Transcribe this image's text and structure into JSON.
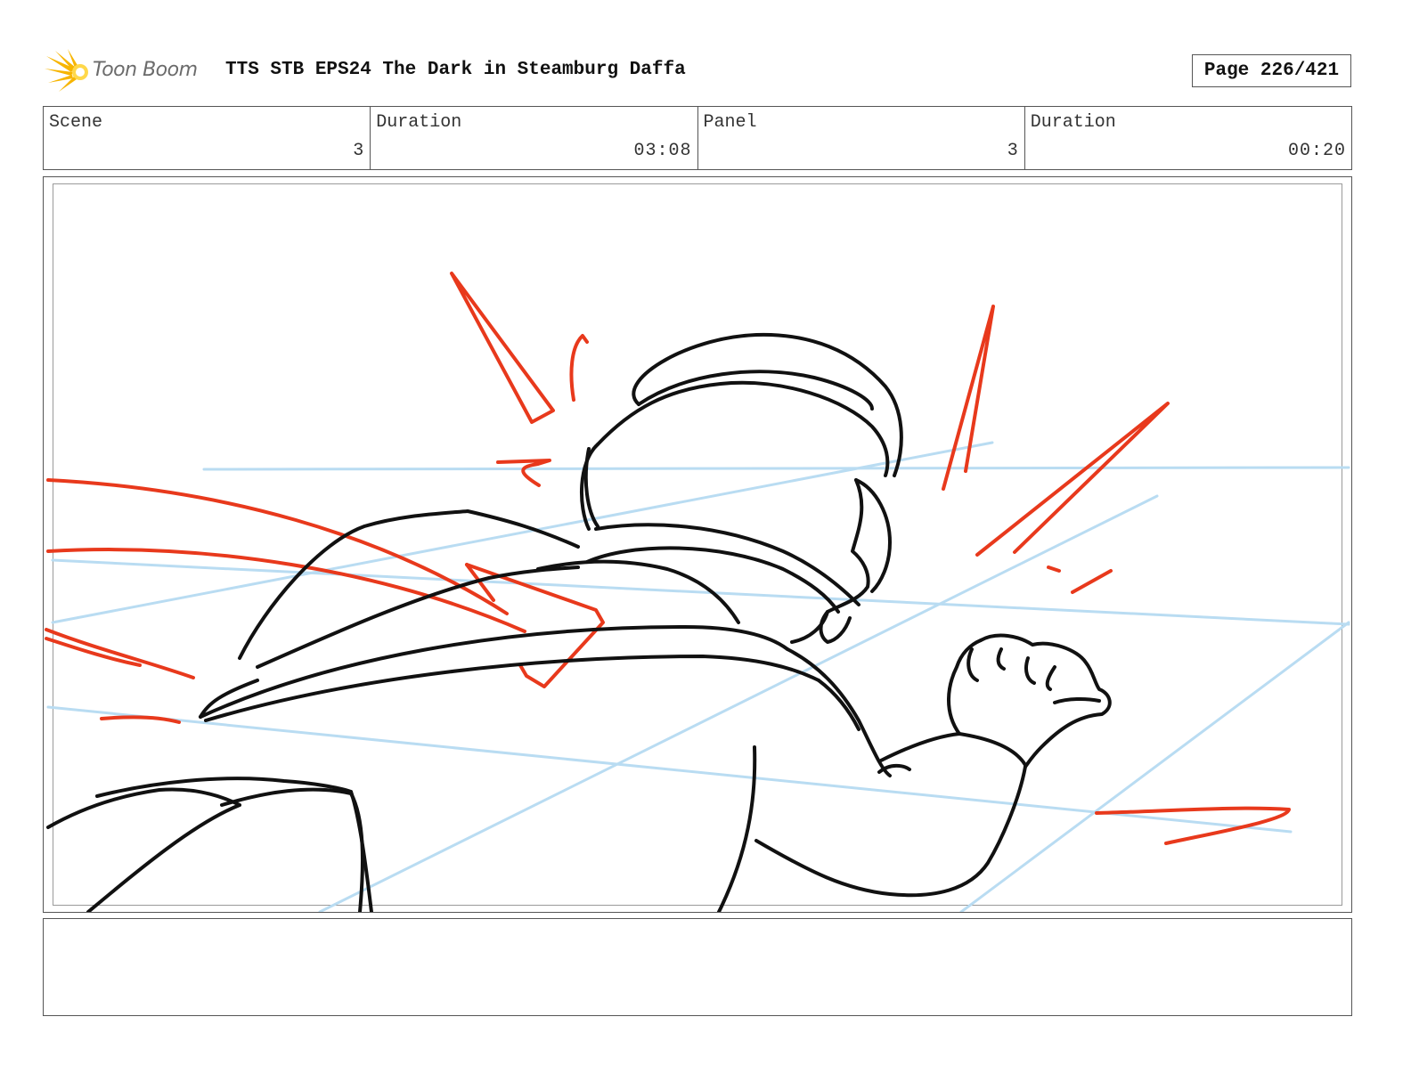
{
  "header": {
    "logo_text": "Toon Boom",
    "title": "TTS STB EPS24 The Dark in Steamburg Daffa",
    "page": "Page 226/421"
  },
  "info": [
    {
      "label": "Scene",
      "value": "3"
    },
    {
      "label": "Duration",
      "value": "03:08"
    },
    {
      "label": "Panel",
      "value": "3"
    },
    {
      "label": "Duration",
      "value": "00:20"
    }
  ],
  "colors": {
    "guide_lines": "#b9dcf2",
    "action_lines": "#e8391c",
    "ink": "#111111",
    "logo": "#f7b500"
  },
  "icons": {
    "logo": "starburst-logo-icon"
  },
  "notes": ""
}
